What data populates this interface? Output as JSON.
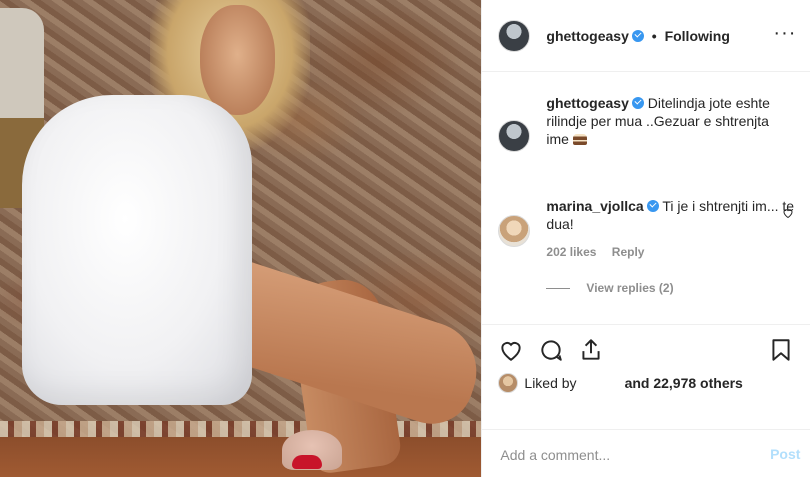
{
  "post": {
    "author": {
      "username": "ghettogeasy",
      "verified": true,
      "follow_status": "Following",
      "dot": "•",
      "more": "···"
    },
    "caption": {
      "username": "ghettogeasy",
      "text": "Ditelindja jote eshte rilindje per mua ..Gezuar e shtrenjta ime",
      "emoji": "cake-icon"
    },
    "comments": [
      {
        "username": "marina_vjollca",
        "verified": true,
        "text": "Ti je i shtrenjti im... te dua!",
        "likes": "202 likes",
        "reply_label": "Reply",
        "view_replies": "View replies (2)"
      }
    ],
    "actions": {
      "liked_by_prefix": "Liked by",
      "likes_count": "and 22,978 others"
    },
    "add_comment": {
      "placeholder": "Add a comment...",
      "post_label": "Post"
    },
    "colors": {
      "accent": "#3897f0",
      "text": "#262626",
      "muted": "#8e8e8e",
      "post_disabled": "#b2dffc",
      "border": "#efefef"
    },
    "icons": [
      "heart-icon",
      "comment-icon",
      "share-icon",
      "bookmark-icon",
      "verified-icon",
      "more-icon"
    ]
  }
}
